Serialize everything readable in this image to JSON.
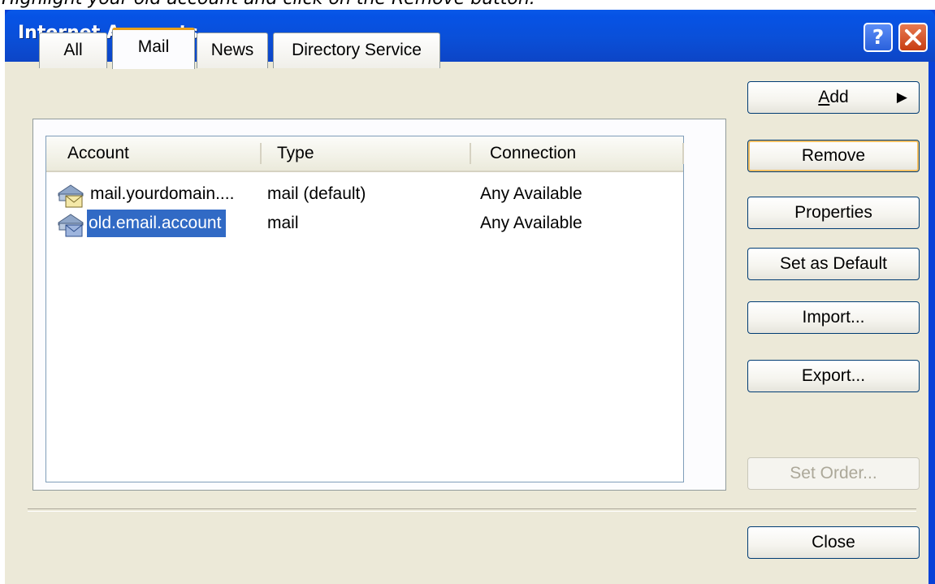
{
  "instruction": "Highlight your old account and click on the Remove button.",
  "window": {
    "title": "Internet Accounts",
    "help_label": "?"
  },
  "tabs": [
    {
      "label": "All"
    },
    {
      "label": "Mail"
    },
    {
      "label": "News"
    },
    {
      "label": "Directory Service"
    }
  ],
  "active_tab": "Mail",
  "list": {
    "columns": [
      "Account",
      "Type",
      "Connection"
    ],
    "rows": [
      {
        "account": "mail.yourdomain....",
        "type": "mail (default)",
        "connection": "Any Available",
        "icon": "mail-account-icon",
        "selected": false
      },
      {
        "account": "old.email.account",
        "type": "mail",
        "connection": "Any Available",
        "icon": "mail-account-icon",
        "selected": true
      }
    ]
  },
  "buttons": {
    "add": {
      "prefix": "",
      "mnemonic": "A",
      "rest": "dd"
    },
    "remove": "Remove",
    "properties": "Properties",
    "set_default": "Set as Default",
    "import": "Import...",
    "export": "Export...",
    "set_order": "Set Order...",
    "close": "Close"
  },
  "colors": {
    "selection": "#316ac5",
    "titlebar": "#0a4fd8",
    "dialog_bg": "#ece9d8"
  }
}
